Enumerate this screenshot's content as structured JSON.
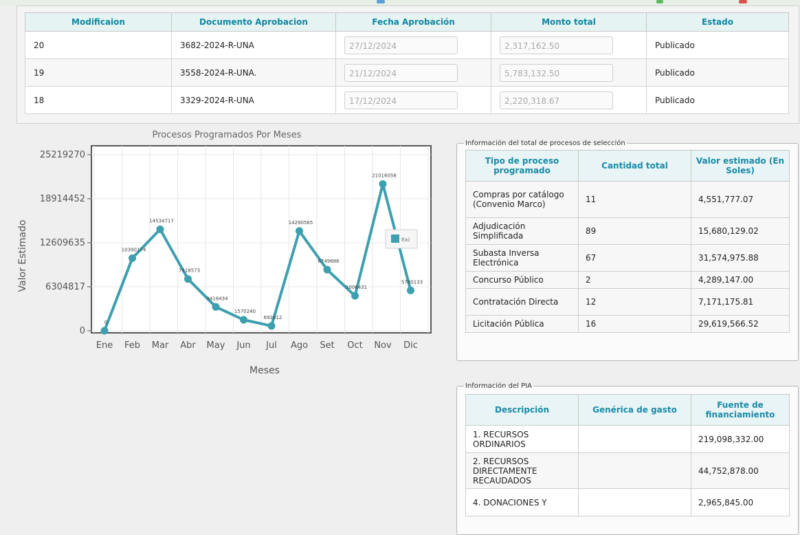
{
  "modifications": {
    "headers": [
      "Modificaion",
      "Documento Aprobacion",
      "Fecha Aprobación",
      "Monto total",
      "Estado"
    ],
    "rows": [
      {
        "mod": "20",
        "doc": "3682-2024-R-UNA",
        "fecha": "27/12/2024",
        "monto": "2,317,162.50",
        "estado": "Publicado"
      },
      {
        "mod": "19",
        "doc": "3558-2024-R-UNA.",
        "fecha": "21/12/2024",
        "monto": "5,783,132.50",
        "estado": "Publicado"
      },
      {
        "mod": "18",
        "doc": "3329-2024-R-UNA",
        "fecha": "17/12/2024",
        "monto": "2,220,318.67",
        "estado": "Publicado"
      }
    ]
  },
  "chart_data": {
    "type": "line",
    "title": "Procesos Programados Por Meses",
    "xlabel": "Meses",
    "ylabel": "Valor Estimado",
    "categories": [
      "Ene",
      "Feb",
      "Mar",
      "Abr",
      "May",
      "Jun",
      "Jul",
      "Ago",
      "Set",
      "Oct",
      "Nov",
      "Dic"
    ],
    "series": [
      {
        "name": "f(x)",
        "values": [
          0,
          10390174,
          14534717,
          7418573,
          3418434,
          1570240,
          692812,
          14290565,
          8749686,
          5006431,
          21016058,
          5780133
        ],
        "labels": [
          "0",
          "10390174",
          "14534717",
          "7418573",
          "3418434",
          "1570240",
          "692812",
          "14290565",
          "8749686",
          "5006431",
          "21016058",
          "5780133"
        ]
      }
    ],
    "yticks": [
      "25219270",
      "18914452",
      "12609635",
      "6304817",
      "0"
    ],
    "ylim": [
      0,
      25219270
    ],
    "grid": true,
    "legend": "right",
    "color": "#3e9fae"
  },
  "procesos": {
    "legend": "Información del total de procesos de selección",
    "headers": [
      "Tipo de proceso programado",
      "Cantidad total",
      "Valor estimado (En Soles)"
    ],
    "rows": [
      {
        "tipo": "Compras por catálogo (Convenio Marco)",
        "cantidad": "11",
        "valor": "4,551,777.07"
      },
      {
        "tipo": "Adjudicación Simplificada",
        "cantidad": "89",
        "valor": "15,680,129.02"
      },
      {
        "tipo": "Subasta Inversa Electrónica",
        "cantidad": "67",
        "valor": "31,574,975.88"
      },
      {
        "tipo": "Concurso Público",
        "cantidad": "2",
        "valor": "4,289,147.00"
      },
      {
        "tipo": "Contratación Directa",
        "cantidad": "12",
        "valor": "7,171,175.81"
      },
      {
        "tipo": "Licitación Pública",
        "cantidad": "16",
        "valor": "29,619,566.52"
      }
    ]
  },
  "pia": {
    "legend": "Información del PIA",
    "headers": [
      "Descripción",
      "Genérica de gasto",
      "Fuente de financiamiento"
    ],
    "rows": [
      {
        "desc": "1. RECURSOS ORDINARIOS",
        "generica": "",
        "fuente": "219,098,332.00"
      },
      {
        "desc": "2. RECURSOS DIRECTAMENTE RECAUDADOS",
        "generica": "",
        "fuente": "44,752,878.00"
      },
      {
        "desc": "4. DONACIONES Y",
        "generica": "",
        "fuente": "2,965,845.00"
      }
    ]
  }
}
